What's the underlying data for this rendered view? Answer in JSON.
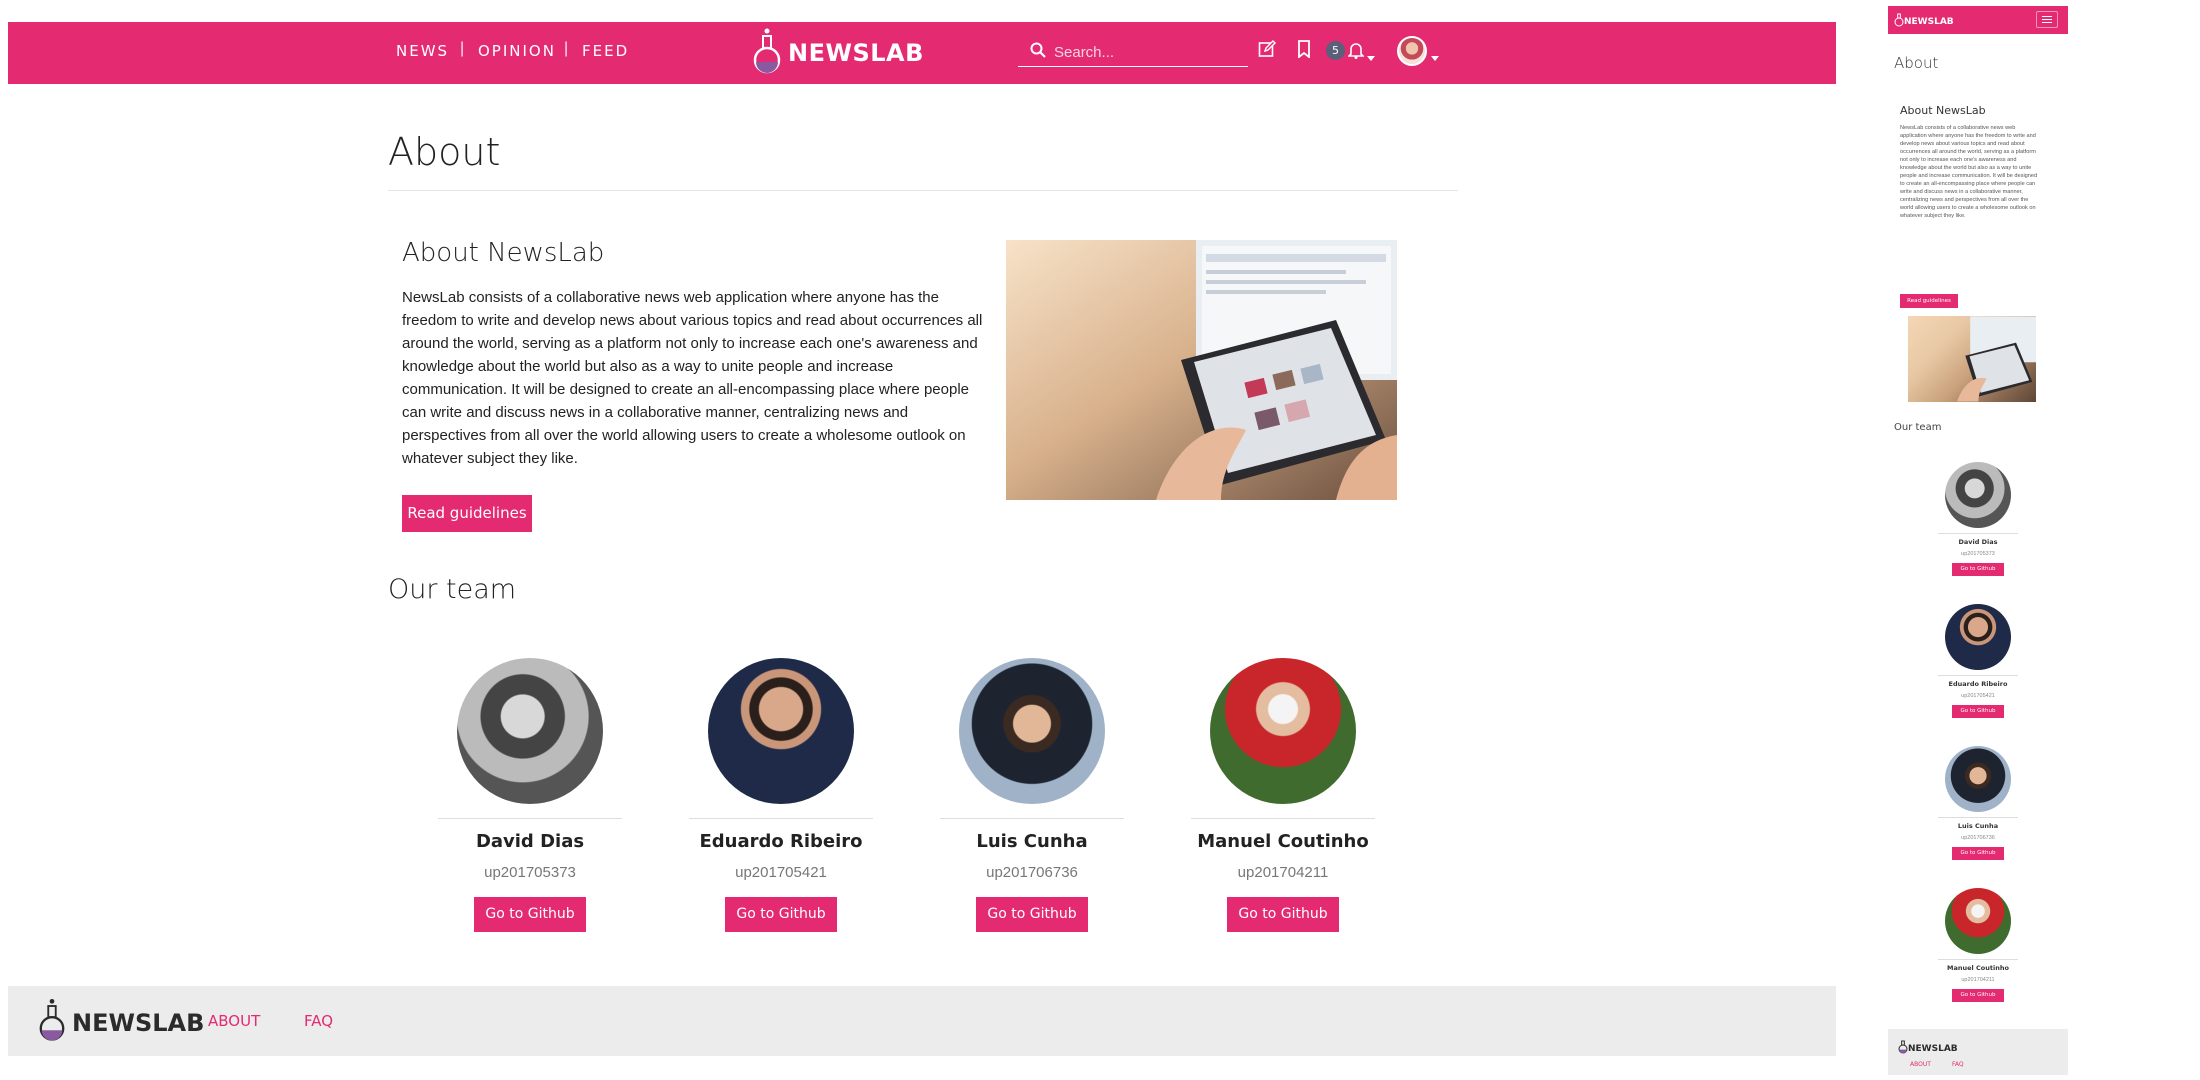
{
  "nav": {
    "links": [
      "NEWS",
      "OPINION",
      "FEED"
    ],
    "brand": "NEWSLAB",
    "search_placeholder": "Search...",
    "notification_count": "5"
  },
  "page": {
    "title": "About"
  },
  "about": {
    "heading": "About NewsLab",
    "text": "NewsLab consists of a collaborative news web application where anyone has the freedom to write and develop news about various topics and read about occurrences all around the world, serving as a platform not only to increase each one's awareness and knowledge about the world but also as a way to unite people and increase communication. It will be designed to create an all-encompassing place where people can write and discuss news in a collaborative manner, centralizing news and perspectives from all over the world allowing users to create a wholesome outlook on whatever subject they like.",
    "button": "Read guidelines"
  },
  "team": {
    "heading": "Our team",
    "button_label": "Go to Github",
    "members": [
      {
        "name": "David Dias",
        "id": "up201705373"
      },
      {
        "name": "Eduardo Ribeiro",
        "id": "up201705421"
      },
      {
        "name": "Luis Cunha",
        "id": "up201706736"
      },
      {
        "name": "Manuel Coutinho",
        "id": "up201704211"
      }
    ]
  },
  "footer": {
    "brand": "NEWSLAB",
    "links": [
      "ABOUT",
      "FAQ"
    ]
  },
  "colors": {
    "accent": "#e42a71",
    "footer_bg": "#ececec",
    "badge": "#5a5f7a"
  },
  "icons": [
    "flask-logo-icon",
    "search-icon",
    "edit-icon",
    "bookmark-icon",
    "bell-icon",
    "caret-down-icon",
    "menu-icon"
  ]
}
